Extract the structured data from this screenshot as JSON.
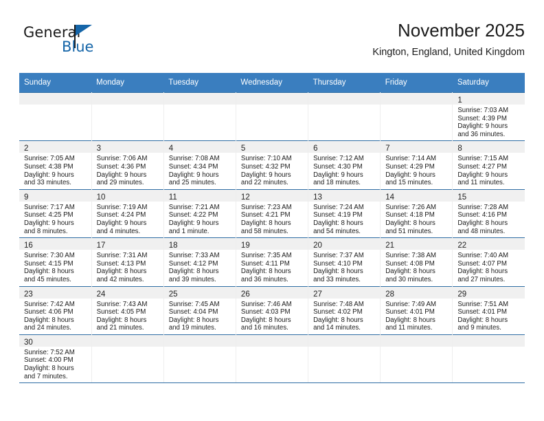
{
  "brand": {
    "name_part1": "General",
    "name_part2": "Blue",
    "accent_color": "#1565a8"
  },
  "header": {
    "title": "November 2025",
    "subtitle": "Kington, England, United Kingdom"
  },
  "theme": {
    "header_row_bg": "#3a7ebf",
    "row_divider": "#2e6da4",
    "daynum_strip_bg": "#f0f0f0"
  },
  "weekdays": [
    "Sunday",
    "Monday",
    "Tuesday",
    "Wednesday",
    "Thursday",
    "Friday",
    "Saturday"
  ],
  "weeks": [
    [
      {
        "day": "",
        "lines": []
      },
      {
        "day": "",
        "lines": []
      },
      {
        "day": "",
        "lines": []
      },
      {
        "day": "",
        "lines": []
      },
      {
        "day": "",
        "lines": []
      },
      {
        "day": "",
        "lines": []
      },
      {
        "day": "1",
        "lines": [
          "Sunrise: 7:03 AM",
          "Sunset: 4:39 PM",
          "Daylight: 9 hours",
          "and 36 minutes."
        ]
      }
    ],
    [
      {
        "day": "2",
        "lines": [
          "Sunrise: 7:05 AM",
          "Sunset: 4:38 PM",
          "Daylight: 9 hours",
          "and 33 minutes."
        ]
      },
      {
        "day": "3",
        "lines": [
          "Sunrise: 7:06 AM",
          "Sunset: 4:36 PM",
          "Daylight: 9 hours",
          "and 29 minutes."
        ]
      },
      {
        "day": "4",
        "lines": [
          "Sunrise: 7:08 AM",
          "Sunset: 4:34 PM",
          "Daylight: 9 hours",
          "and 25 minutes."
        ]
      },
      {
        "day": "5",
        "lines": [
          "Sunrise: 7:10 AM",
          "Sunset: 4:32 PM",
          "Daylight: 9 hours",
          "and 22 minutes."
        ]
      },
      {
        "day": "6",
        "lines": [
          "Sunrise: 7:12 AM",
          "Sunset: 4:30 PM",
          "Daylight: 9 hours",
          "and 18 minutes."
        ]
      },
      {
        "day": "7",
        "lines": [
          "Sunrise: 7:14 AM",
          "Sunset: 4:29 PM",
          "Daylight: 9 hours",
          "and 15 minutes."
        ]
      },
      {
        "day": "8",
        "lines": [
          "Sunrise: 7:15 AM",
          "Sunset: 4:27 PM",
          "Daylight: 9 hours",
          "and 11 minutes."
        ]
      }
    ],
    [
      {
        "day": "9",
        "lines": [
          "Sunrise: 7:17 AM",
          "Sunset: 4:25 PM",
          "Daylight: 9 hours",
          "and 8 minutes."
        ]
      },
      {
        "day": "10",
        "lines": [
          "Sunrise: 7:19 AM",
          "Sunset: 4:24 PM",
          "Daylight: 9 hours",
          "and 4 minutes."
        ]
      },
      {
        "day": "11",
        "lines": [
          "Sunrise: 7:21 AM",
          "Sunset: 4:22 PM",
          "Daylight: 9 hours",
          "and 1 minute."
        ]
      },
      {
        "day": "12",
        "lines": [
          "Sunrise: 7:23 AM",
          "Sunset: 4:21 PM",
          "Daylight: 8 hours",
          "and 58 minutes."
        ]
      },
      {
        "day": "13",
        "lines": [
          "Sunrise: 7:24 AM",
          "Sunset: 4:19 PM",
          "Daylight: 8 hours",
          "and 54 minutes."
        ]
      },
      {
        "day": "14",
        "lines": [
          "Sunrise: 7:26 AM",
          "Sunset: 4:18 PM",
          "Daylight: 8 hours",
          "and 51 minutes."
        ]
      },
      {
        "day": "15",
        "lines": [
          "Sunrise: 7:28 AM",
          "Sunset: 4:16 PM",
          "Daylight: 8 hours",
          "and 48 minutes."
        ]
      }
    ],
    [
      {
        "day": "16",
        "lines": [
          "Sunrise: 7:30 AM",
          "Sunset: 4:15 PM",
          "Daylight: 8 hours",
          "and 45 minutes."
        ]
      },
      {
        "day": "17",
        "lines": [
          "Sunrise: 7:31 AM",
          "Sunset: 4:13 PM",
          "Daylight: 8 hours",
          "and 42 minutes."
        ]
      },
      {
        "day": "18",
        "lines": [
          "Sunrise: 7:33 AM",
          "Sunset: 4:12 PM",
          "Daylight: 8 hours",
          "and 39 minutes."
        ]
      },
      {
        "day": "19",
        "lines": [
          "Sunrise: 7:35 AM",
          "Sunset: 4:11 PM",
          "Daylight: 8 hours",
          "and 36 minutes."
        ]
      },
      {
        "day": "20",
        "lines": [
          "Sunrise: 7:37 AM",
          "Sunset: 4:10 PM",
          "Daylight: 8 hours",
          "and 33 minutes."
        ]
      },
      {
        "day": "21",
        "lines": [
          "Sunrise: 7:38 AM",
          "Sunset: 4:08 PM",
          "Daylight: 8 hours",
          "and 30 minutes."
        ]
      },
      {
        "day": "22",
        "lines": [
          "Sunrise: 7:40 AM",
          "Sunset: 4:07 PM",
          "Daylight: 8 hours",
          "and 27 minutes."
        ]
      }
    ],
    [
      {
        "day": "23",
        "lines": [
          "Sunrise: 7:42 AM",
          "Sunset: 4:06 PM",
          "Daylight: 8 hours",
          "and 24 minutes."
        ]
      },
      {
        "day": "24",
        "lines": [
          "Sunrise: 7:43 AM",
          "Sunset: 4:05 PM",
          "Daylight: 8 hours",
          "and 21 minutes."
        ]
      },
      {
        "day": "25",
        "lines": [
          "Sunrise: 7:45 AM",
          "Sunset: 4:04 PM",
          "Daylight: 8 hours",
          "and 19 minutes."
        ]
      },
      {
        "day": "26",
        "lines": [
          "Sunrise: 7:46 AM",
          "Sunset: 4:03 PM",
          "Daylight: 8 hours",
          "and 16 minutes."
        ]
      },
      {
        "day": "27",
        "lines": [
          "Sunrise: 7:48 AM",
          "Sunset: 4:02 PM",
          "Daylight: 8 hours",
          "and 14 minutes."
        ]
      },
      {
        "day": "28",
        "lines": [
          "Sunrise: 7:49 AM",
          "Sunset: 4:01 PM",
          "Daylight: 8 hours",
          "and 11 minutes."
        ]
      },
      {
        "day": "29",
        "lines": [
          "Sunrise: 7:51 AM",
          "Sunset: 4:01 PM",
          "Daylight: 8 hours",
          "and 9 minutes."
        ]
      }
    ],
    [
      {
        "day": "30",
        "lines": [
          "Sunrise: 7:52 AM",
          "Sunset: 4:00 PM",
          "Daylight: 8 hours",
          "and 7 minutes."
        ]
      },
      {
        "day": "",
        "lines": []
      },
      {
        "day": "",
        "lines": []
      },
      {
        "day": "",
        "lines": []
      },
      {
        "day": "",
        "lines": []
      },
      {
        "day": "",
        "lines": []
      },
      {
        "day": "",
        "lines": []
      }
    ]
  ]
}
